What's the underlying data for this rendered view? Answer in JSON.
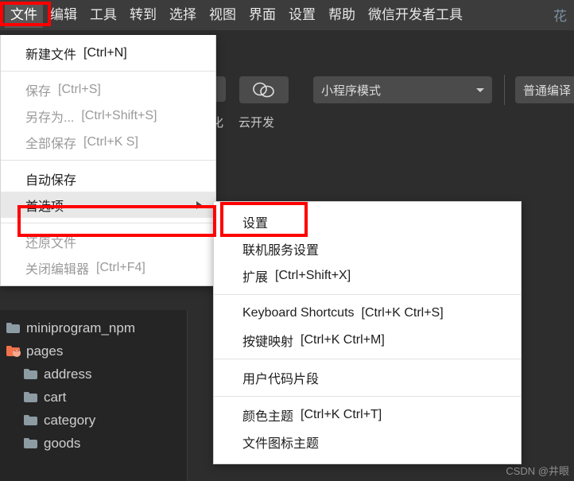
{
  "menubar": {
    "items": [
      {
        "label": "文件",
        "active": true
      },
      {
        "label": "编辑",
        "active": false
      },
      {
        "label": "工具",
        "active": false
      },
      {
        "label": "转到",
        "active": false
      },
      {
        "label": "选择",
        "active": false
      },
      {
        "label": "视图",
        "active": false
      },
      {
        "label": "界面",
        "active": false
      },
      {
        "label": "设置",
        "active": false
      },
      {
        "label": "帮助",
        "active": false
      },
      {
        "label": "微信开发者工具",
        "active": false
      }
    ],
    "trailing_partial": "花"
  },
  "toolbar": {
    "cloud_icon": "cloud-link-icon",
    "mode_select_value": "小程序模式",
    "compile_label": "普通编译",
    "sub_partial_label": "化",
    "sub_cloud_label": "云开发"
  },
  "file_menu": {
    "groups": [
      [
        {
          "label": "新建文件",
          "accel": "[Ctrl+N]",
          "disabled": false,
          "selected": false,
          "submenu": false
        }
      ],
      [
        {
          "label": "保存",
          "accel": "[Ctrl+S]",
          "disabled": true,
          "selected": false,
          "submenu": false
        },
        {
          "label": "另存为...",
          "accel": "[Ctrl+Shift+S]",
          "disabled": true,
          "selected": false,
          "submenu": false
        },
        {
          "label": "全部保存",
          "accel": "[Ctrl+K S]",
          "disabled": true,
          "selected": false,
          "submenu": false
        }
      ],
      [
        {
          "label": "自动保存",
          "accel": "",
          "disabled": false,
          "selected": false,
          "submenu": false
        },
        {
          "label": "首选项",
          "accel": "",
          "disabled": false,
          "selected": true,
          "submenu": true
        }
      ],
      [
        {
          "label": "还原文件",
          "accel": "",
          "disabled": true,
          "selected": false,
          "submenu": false
        },
        {
          "label": "关闭编辑器",
          "accel": "[Ctrl+F4]",
          "disabled": true,
          "selected": false,
          "submenu": false
        }
      ]
    ]
  },
  "pref_submenu": {
    "groups": [
      [
        {
          "label": "设置",
          "accel": "",
          "disabled": false
        },
        {
          "label": "联机服务设置",
          "accel": "",
          "disabled": false
        },
        {
          "label": "扩展",
          "accel": "[Ctrl+Shift+X]",
          "disabled": false
        }
      ],
      [
        {
          "label": "Keyboard Shortcuts",
          "accel": "[Ctrl+K Ctrl+S]",
          "disabled": false
        },
        {
          "label": "按键映射",
          "accel": "[Ctrl+K Ctrl+M]",
          "disabled": false
        }
      ],
      [
        {
          "label": "用户代码片段",
          "accel": "",
          "disabled": false
        }
      ],
      [
        {
          "label": "颜色主题",
          "accel": "[Ctrl+K Ctrl+T]",
          "disabled": false
        },
        {
          "label": "文件图标主题",
          "accel": "",
          "disabled": false
        }
      ]
    ]
  },
  "filetree": {
    "items": [
      {
        "label": "miniprogram_npm",
        "indent": 0,
        "color": "gray"
      },
      {
        "label": "pages",
        "indent": 0,
        "color": "orange"
      },
      {
        "label": "address",
        "indent": 1,
        "color": "gray"
      },
      {
        "label": "cart",
        "indent": 1,
        "color": "gray"
      },
      {
        "label": "category",
        "indent": 1,
        "color": "gray"
      },
      {
        "label": "goods",
        "indent": 1,
        "color": "gray"
      }
    ]
  },
  "annotations": {
    "color": "#ff0000",
    "boxes": [
      "文件",
      "首选项",
      "设置"
    ]
  },
  "watermark": {
    "text": "CSDN @井眼"
  }
}
